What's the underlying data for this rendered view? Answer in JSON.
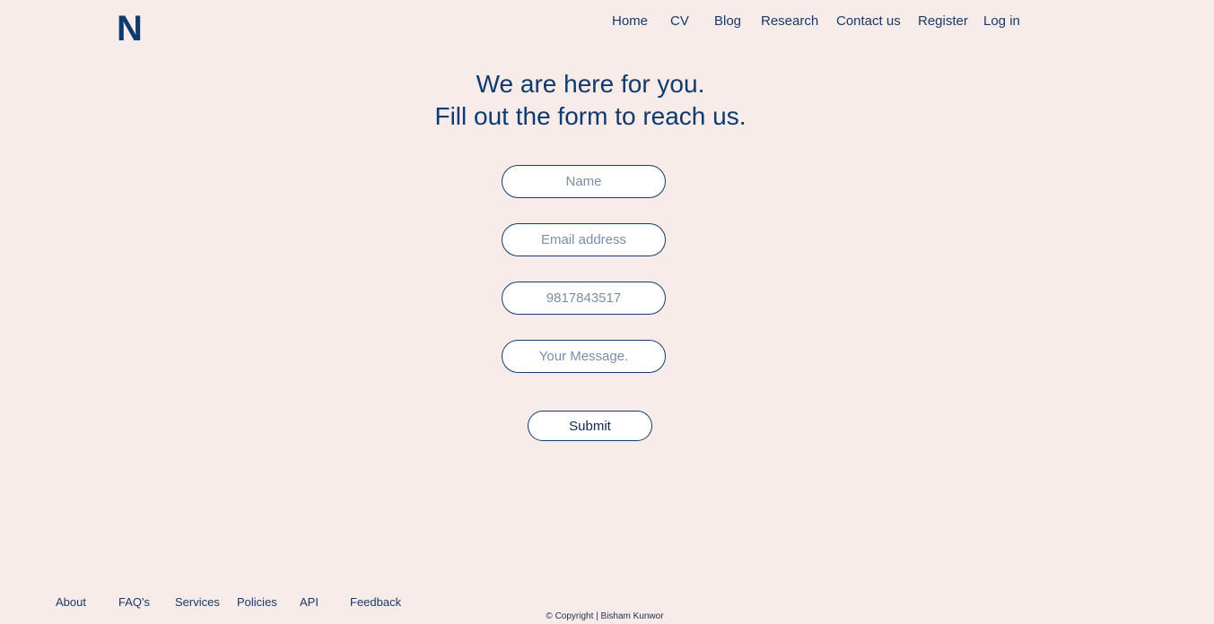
{
  "brand": {
    "logo_text": "N"
  },
  "nav": {
    "items": [
      {
        "label": "Home"
      },
      {
        "label": "CV"
      },
      {
        "label": "Blog"
      },
      {
        "label": "Research"
      },
      {
        "label": "Contact us"
      },
      {
        "label": "Register"
      },
      {
        "label": "Log in"
      }
    ]
  },
  "hero": {
    "line1": "We are here for you.",
    "line2": "Fill out the form to reach us."
  },
  "form": {
    "name_placeholder": "Name",
    "email_placeholder": "Email address",
    "phone_placeholder": "9817843517",
    "message_placeholder": "Your Message.",
    "submit_label": "Submit"
  },
  "footer": {
    "links": [
      {
        "label": "About"
      },
      {
        "label": "FAQ's"
      },
      {
        "label": "Services"
      },
      {
        "label": "Policies"
      },
      {
        "label": "API"
      },
      {
        "label": "Feedback"
      }
    ],
    "copyright": "© Copyright | Bisham Kunwor"
  },
  "colors": {
    "background": "#f8eceb",
    "brand": "#0f3a6e",
    "text": "#163a6b"
  }
}
